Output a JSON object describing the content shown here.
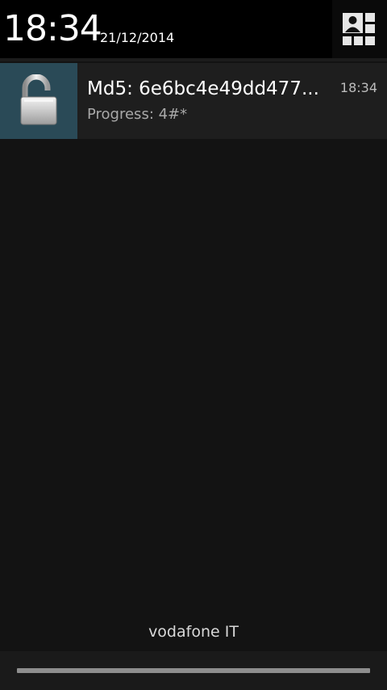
{
  "status_header": {
    "time": "18:34",
    "date": "21/12/2014",
    "settings_icon": "quick-settings-icon"
  },
  "notification": {
    "icon": "unlocked-padlock-icon",
    "title": "Md5: 6e6bc4e49dd477...",
    "time": "18:34",
    "text": "Progress: 4#*"
  },
  "footer": {
    "carrier": "vodafone IT"
  },
  "colors": {
    "background": "#131313",
    "header": "#000000",
    "notification_bg": "#1e1e1e",
    "icon_bg": "#2a4a57"
  }
}
